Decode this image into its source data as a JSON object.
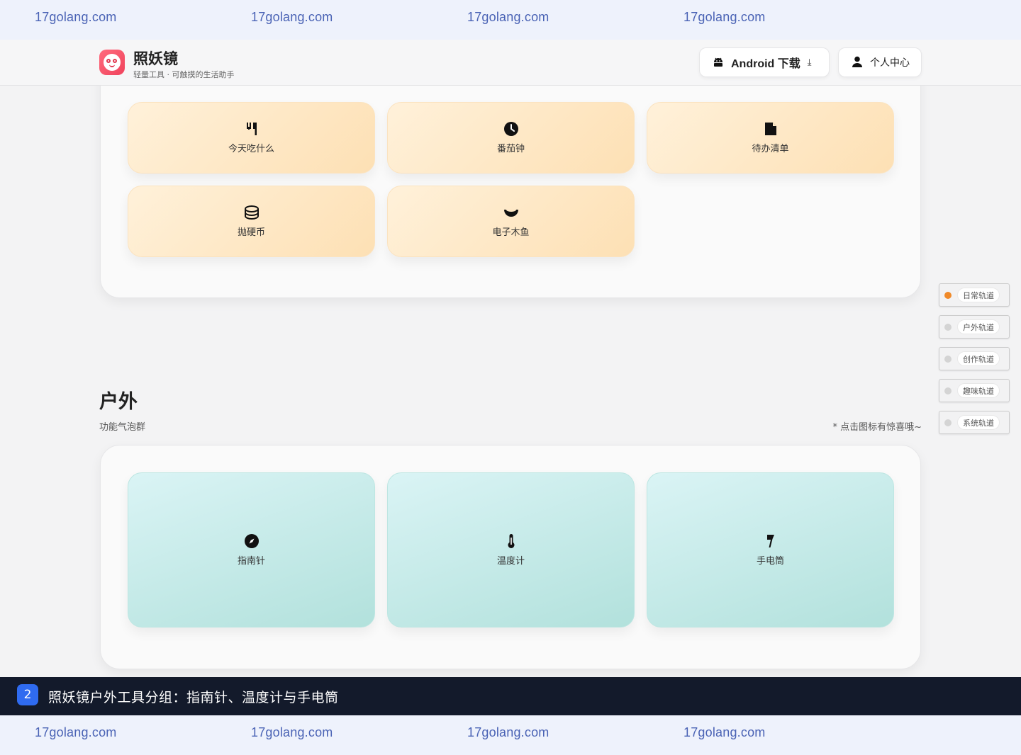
{
  "watermark": {
    "text": "17golang.com"
  },
  "header": {
    "app_name": "照妖镜",
    "tagline": "轻量工具 · 可触摸的生活助手",
    "android_button": "Android 下载",
    "profile_button": "个人中心"
  },
  "daily_tools": [
    {
      "label": "今天吃什么",
      "icon": "utensils-icon"
    },
    {
      "label": "番茄钟",
      "icon": "clock-icon"
    },
    {
      "label": "待办清单",
      "icon": "file-icon"
    },
    {
      "label": "抛硬币",
      "icon": "coin-stack-icon"
    },
    {
      "label": "电子木鱼",
      "icon": "wooden-fish-icon"
    }
  ],
  "outdoor_section": {
    "title": "户外",
    "subtitle": "功能气泡群",
    "hint": "* 点击图标有惊喜哦~",
    "tools": [
      {
        "label": "指南针",
        "icon": "compass-icon"
      },
      {
        "label": "温度计",
        "icon": "thermometer-icon"
      },
      {
        "label": "手电筒",
        "icon": "flashlight-icon"
      }
    ]
  },
  "side_nav": {
    "active_index": 0,
    "items": [
      "日常轨道",
      "户外轨道",
      "创作轨道",
      "趣味轨道",
      "系统轨道"
    ],
    "active_color": "#f08a2a"
  },
  "caption": {
    "number": "2",
    "text": "照妖镜户外工具分组：指南针、温度计与手电筒"
  }
}
